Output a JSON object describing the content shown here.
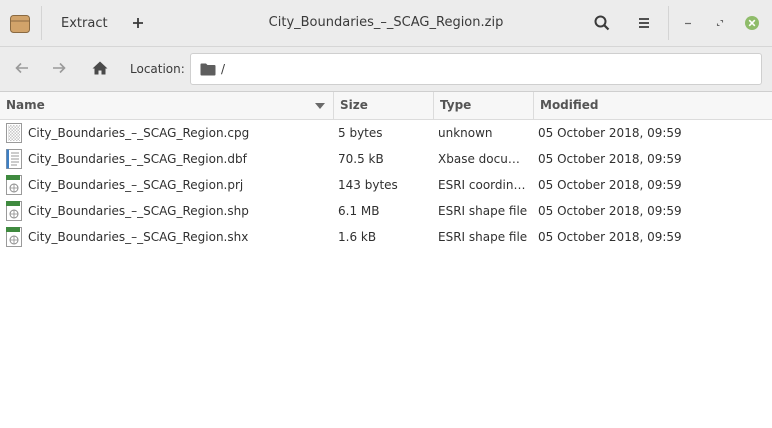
{
  "window": {
    "title": "City_Boundaries_–_SCAG_Region.zip",
    "extract_label": "Extract"
  },
  "icons": {
    "app": "archive-app-icon",
    "add": "plus-icon",
    "search": "search-icon",
    "menu": "hamburger-menu-icon",
    "minimize": "minimize-icon",
    "restore": "restore-icon",
    "close": "close-icon",
    "back": "arrow-left-icon",
    "forward": "arrow-right-icon",
    "home": "home-icon",
    "folder": "folder-icon"
  },
  "colors": {
    "close_button": "#8fbc6a",
    "app_icon": "#d1a36a",
    "toolbar_bg": "#ececec"
  },
  "location": {
    "label": "Location:",
    "path": "/"
  },
  "columns": {
    "name": "Name",
    "size": "Size",
    "type": "Type",
    "modified": "Modified"
  },
  "files": [
    {
      "name": "City_Boundaries_–_SCAG_Region.cpg",
      "size": "5 bytes",
      "type": "unknown",
      "modified": "05 October 2018, 09:59",
      "icon": "unknown-file-icon"
    },
    {
      "name": "City_Boundaries_–_SCAG_Region.dbf",
      "size": "70.5 kB",
      "type": "Xbase document",
      "modified": "05 October 2018, 09:59",
      "icon": "database-file-icon"
    },
    {
      "name": "City_Boundaries_–_SCAG_Region.prj",
      "size": "143 bytes",
      "type": "ESRI coordinate",
      "modified": "05 October 2018, 09:59",
      "icon": "esri-file-icon"
    },
    {
      "name": "City_Boundaries_–_SCAG_Region.shp",
      "size": "6.1 MB",
      "type": "ESRI shape file",
      "modified": "05 October 2018, 09:59",
      "icon": "esri-file-icon"
    },
    {
      "name": "City_Boundaries_–_SCAG_Region.shx",
      "size": "1.6 kB",
      "type": "ESRI shape file",
      "modified": "05 October 2018, 09:59",
      "icon": "esri-file-icon"
    }
  ]
}
